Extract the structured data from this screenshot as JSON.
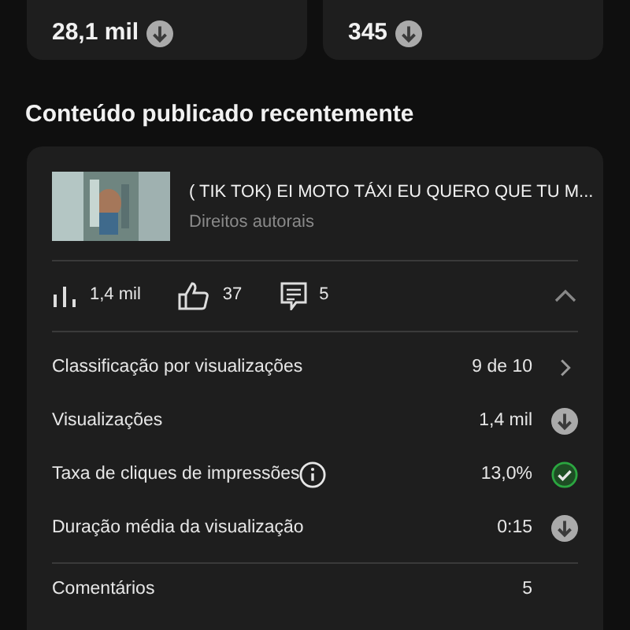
{
  "summary_cards": [
    {
      "value": "28,1 mil",
      "kind": "down"
    },
    {
      "value": "345",
      "kind": "down"
    }
  ],
  "section_title": "Conteúdo publicado recentemente",
  "video": {
    "kind": "picture",
    "title": "( TIK TOK) EI MOTO TÁXI EU QUERO QUE TU M...",
    "subtitle": "Direitos autorais"
  },
  "stats": [
    {
      "kind": "views",
      "value": "1,4 mil"
    },
    {
      "kind": "likes",
      "value": "37"
    },
    {
      "kind": "comments",
      "value": "5"
    }
  ],
  "expanded": true,
  "metrics": [
    {
      "label": "Classificação por visualizações",
      "value": "9 de 10",
      "kind": "chevron",
      "info": false
    },
    {
      "label": "Visualizações",
      "value": "1,4 mil",
      "kind": "down",
      "info": false
    },
    {
      "label": "Taxa de cliques de impressões",
      "value": "13,0%",
      "kind": "check",
      "info": true
    },
    {
      "label": "Duração média da visualização",
      "value": "0:15",
      "kind": "down",
      "info": false
    }
  ],
  "footer_row": {
    "label": "Comentários",
    "value": "5"
  }
}
